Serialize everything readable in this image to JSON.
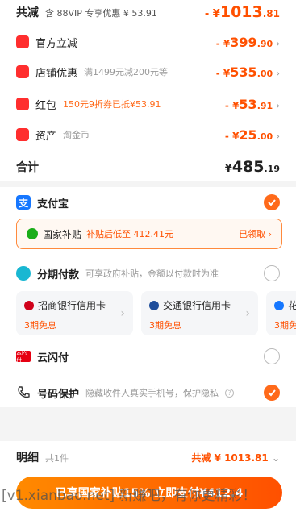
{
  "summary": {
    "total_discount_label": "共减",
    "total_discount_note": "含 88VIP 专享优惠 ¥ 53.91",
    "total_discount_prefix": "- ¥",
    "total_discount_int": "1013",
    "total_discount_dec": ".81",
    "items": [
      {
        "label": "官方立减",
        "note": "",
        "prefix": "- ¥",
        "int": "399",
        "dec": ".90",
        "icon": "lightning-icon",
        "note_color": "#999"
      },
      {
        "label": "店铺优惠",
        "note": "满1499元减200元等",
        "prefix": "- ¥",
        "int": "535",
        "dec": ".00",
        "icon": "shop-coupon-icon",
        "note_color": "#999"
      },
      {
        "label": "红包",
        "note": "150元9折券已抵¥53.91",
        "prefix": "- ¥",
        "int": "53",
        "dec": ".91",
        "icon": "red-packet-icon",
        "note_color": "#ff6a1a"
      },
      {
        "label": "资产",
        "note": "淘金币",
        "prefix": "- ¥",
        "int": "25",
        "dec": ".00",
        "icon": "tag-icon",
        "note_color": "#999"
      }
    ],
    "subtotal_label": "合计",
    "subtotal_prefix": "¥",
    "subtotal_int": "485",
    "subtotal_dec": ".19"
  },
  "payment": {
    "alipay_label": "支付宝",
    "subsidy_label": "国家补贴",
    "subsidy_note": "补贴后低至 412.41元",
    "subsidy_status": "已领取",
    "installment_label": "分期付款",
    "installment_note": "可享政府补贴，金额以付款时为准",
    "cards": [
      {
        "bank": "招商银行信用卡",
        "promo": "3期免息",
        "logo": "cmb-logo-icon"
      },
      {
        "bank": "交通银行信用卡",
        "promo": "3期免息",
        "logo": "bocom-logo-icon"
      },
      {
        "bank": "花",
        "promo": "3期免",
        "logo": "huabei-logo-icon"
      }
    ],
    "unionpay_label": "云闪付",
    "privacy_label": "号码保护",
    "privacy_note": "隐藏收件人真实手机号，保护隐私"
  },
  "footer": {
    "detail_label": "明细",
    "detail_count": "共1件",
    "detail_total": "共减 ¥ 1013.81",
    "pay_button": "已享国家补贴15% 立即支付¥412.4",
    "watermark": "[v1.xianbao.net] 新赚吧，有你更精彩！"
  },
  "colors": {
    "accent": "#ff5000",
    "alipay": "#1677ff"
  }
}
